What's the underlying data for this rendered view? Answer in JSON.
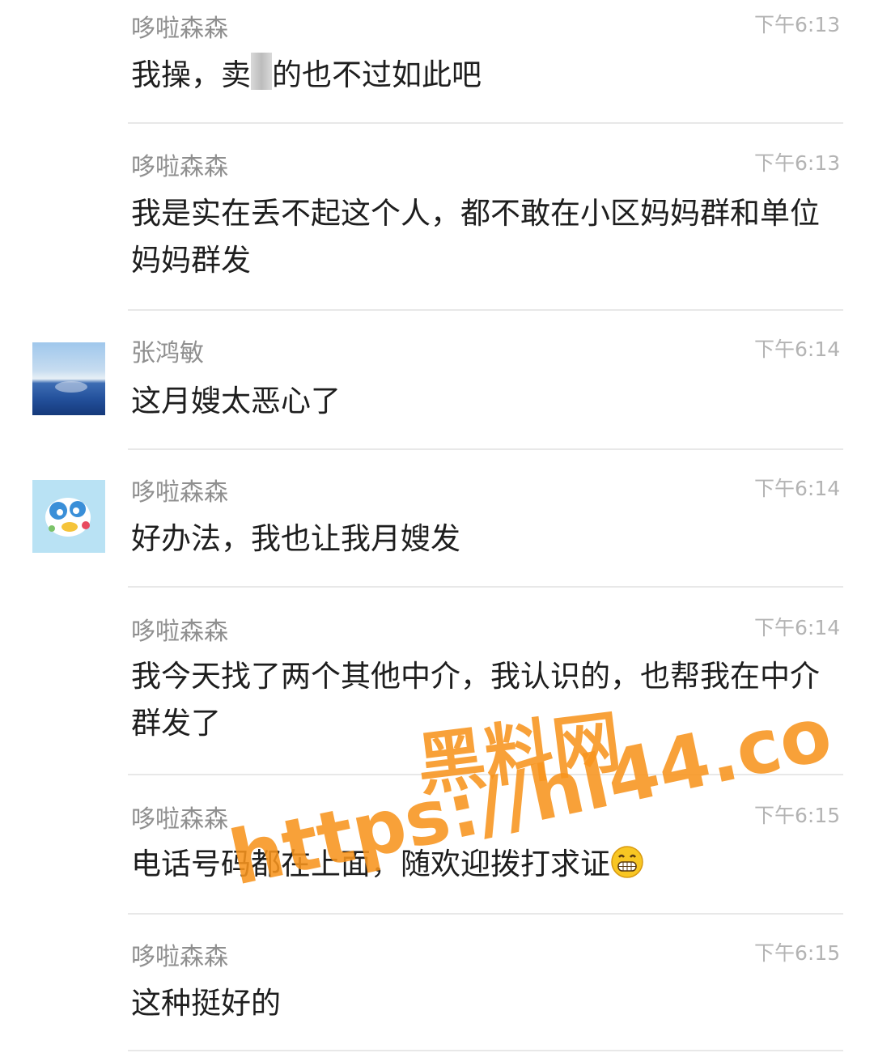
{
  "messages": [
    {
      "sender": "哆啦森森",
      "time": "下午6:13",
      "text_before": "我操，卖",
      "text_after": "的也不过如此吧"
    },
    {
      "sender": "哆啦森森",
      "time": "下午6:13",
      "text": "我是实在丢不起这个人，都不敢在小区妈妈群和单位妈妈群发"
    },
    {
      "sender": "张鸿敏",
      "time": "下午6:14",
      "text": "这月嫂太恶心了",
      "avatar": "sea-landscape-avatar"
    },
    {
      "sender": "哆啦森森",
      "time": "下午6:14",
      "text": "好办法，我也让我月嫂发",
      "avatar": "cartoon-avatar"
    },
    {
      "sender": "哆啦森森",
      "time": "下午6:14",
      "text": "我今天找了两个其他中介，我认识的，也帮我在中介群发了"
    },
    {
      "sender": "哆啦森森",
      "time": "下午6:15",
      "text": "电话号码都在上面，随欢迎拨打求证",
      "emoji": "grinning-face-emoji"
    },
    {
      "sender": "哆啦森森",
      "time": "下午6:15",
      "text": "这种挺好的"
    }
  ],
  "watermark": {
    "title": "黑料网",
    "url": "https://hl44.co",
    "color": "#f7941e"
  }
}
